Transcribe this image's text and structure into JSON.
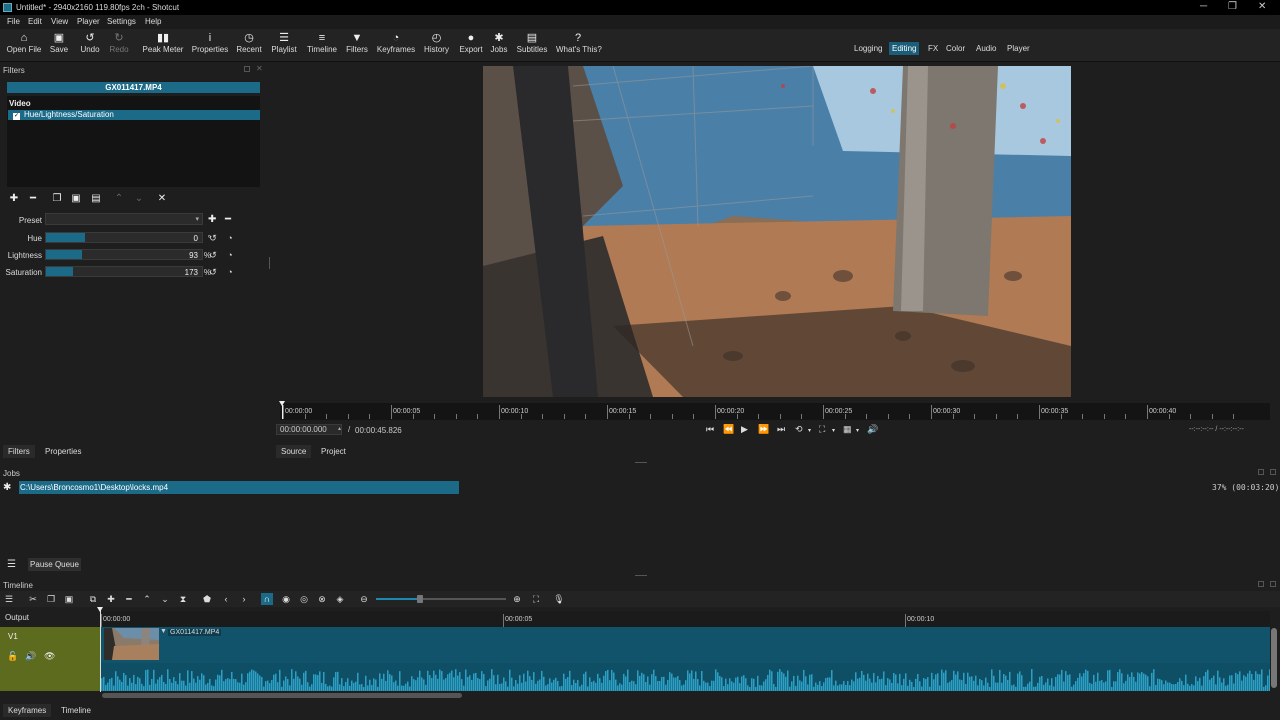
{
  "window": {
    "title": "Untitled* - 2940x2160 119.80fps 2ch - Shotcut",
    "minimize": "─",
    "restore": "❐",
    "close": "✕"
  },
  "menu": [
    "File",
    "Edit",
    "View",
    "Player",
    "Settings",
    "Help"
  ],
  "toolbar": [
    {
      "label": "Open File",
      "icon": "folder-icon",
      "glyph": "⌂"
    },
    {
      "label": "Save",
      "icon": "save-icon",
      "glyph": "▣"
    },
    {
      "label": "Undo",
      "icon": "undo-icon",
      "glyph": "↺"
    },
    {
      "label": "Redo",
      "icon": "redo-icon",
      "glyph": "↻",
      "disabled": true
    },
    {
      "label": "Peak Meter",
      "icon": "peak-meter-icon",
      "glyph": "▮▮"
    },
    {
      "label": "Properties",
      "icon": "info-icon",
      "glyph": "i"
    },
    {
      "label": "Recent",
      "icon": "clock-icon",
      "glyph": "◷"
    },
    {
      "label": "Playlist",
      "icon": "list-icon",
      "glyph": "☰"
    },
    {
      "label": "Timeline",
      "icon": "timeline-icon",
      "glyph": "≡"
    },
    {
      "label": "Filters",
      "icon": "funnel-icon",
      "glyph": "▼"
    },
    {
      "label": "Keyframes",
      "icon": "stopwatch-icon",
      "glyph": "◔"
    },
    {
      "label": "History",
      "icon": "history-icon",
      "glyph": "◴"
    },
    {
      "label": "Export",
      "icon": "export-icon",
      "glyph": "●"
    },
    {
      "label": "Jobs",
      "icon": "gear-icon",
      "glyph": "✱"
    },
    {
      "label": "Subtitles",
      "icon": "subtitles-icon",
      "glyph": "▤"
    },
    {
      "label": "What's This?",
      "icon": "question-icon",
      "glyph": "?"
    }
  ],
  "layouts": [
    "Logging",
    "Editing",
    "FX",
    "Color",
    "Audio",
    "Player"
  ],
  "layout_active": "Editing",
  "filters_panel": {
    "title": "Filters",
    "clip_name": "GX011417.MP4",
    "section": "Video",
    "check": "✓",
    "filter_item": "Hue/Lightness/Saturation",
    "preset_label": "Preset",
    "params": [
      {
        "label": "Hue",
        "value": "0",
        "unit": "°",
        "fill": 0.25
      },
      {
        "label": "Lightness",
        "value": "93",
        "unit": "%",
        "fill": 0.23
      },
      {
        "label": "Saturation",
        "value": "173",
        "unit": "%",
        "fill": 0.17
      }
    ]
  },
  "player": {
    "ruler_labels": [
      "00:00:00",
      "00:00:05",
      "00:00:10",
      "00:00:15",
      "00:00:20",
      "00:00:25",
      "00:00:30",
      "00:00:35",
      "00:00:40"
    ],
    "current_time": "00:00:00.000",
    "separator": "/",
    "duration": "00:00:45.826",
    "in_out": "--:--:--:-- / --:--:--:--"
  },
  "bottom_tabs_left": [
    "Filters",
    "Properties"
  ],
  "bottom_tabs_right": [
    "Source",
    "Project"
  ],
  "jobs": {
    "title": "Jobs",
    "job_path": "C:\\Users\\Broncosmo1\\Desktop\\locks.mp4",
    "job_status": "37% (00:03:20)",
    "pause_label": "Pause Queue"
  },
  "timeline": {
    "title": "Timeline",
    "output_label": "Output",
    "track_name": "V1",
    "clip_name": "GX011417.MP4",
    "ruler_labels": [
      "00:00:00",
      "00:00:05",
      "00:00:10"
    ]
  },
  "bottom_tabs": [
    "Keyframes",
    "Timeline"
  ],
  "colors": {
    "accent": "#1a6a88",
    "track_head": "#5d6b1f",
    "clip": "#11536a",
    "waveform": "#2b9fc4"
  }
}
